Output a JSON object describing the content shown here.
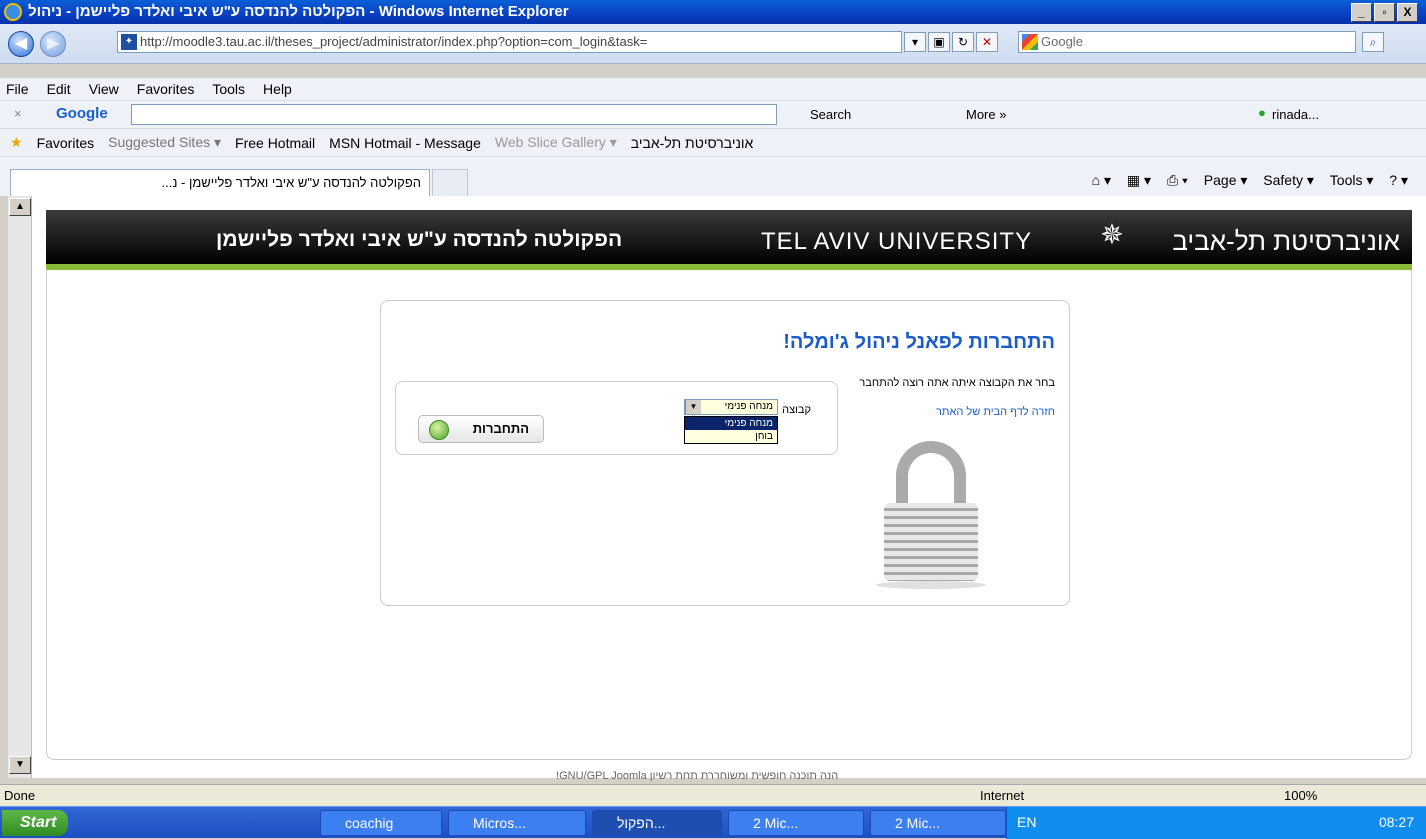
{
  "window": {
    "title": "הפקולטה להנדסה ע\"ש איבי ואלדר פליישמן - ניהול - Windows Internet Explorer",
    "min": "_",
    "max": "▫",
    "close": "X"
  },
  "addressbar": {
    "url": "http://moodle3.tau.ac.il/theses_project/administrator/index.php?option=com_login&task=",
    "search_placeholder": "Google"
  },
  "menu": [
    "File",
    "Edit",
    "View",
    "Favorites",
    "Tools",
    "Help"
  ],
  "googlebar": {
    "logo": "Google",
    "search": "Search",
    "more": "More »",
    "user": "rinada..."
  },
  "favorites": {
    "label": "Favorites",
    "items": [
      "Suggested Sites ▾",
      "Free Hotmail",
      "MSN Hotmail - Message",
      "Web Slice Gallery ▾",
      "אוניברסיטת תל-אביב"
    ]
  },
  "tab": {
    "label": "הפקולטה להנדסה ע\"ש איבי ואלדר פליישמן - נ..."
  },
  "commands": [
    "Page ▾",
    "Safety ▾",
    "Tools ▾"
  ],
  "header": {
    "faculty": "הפקולטה להנדסה ע\"ש איבי ואלדר פליישמן",
    "university_en": "TEL AVIV UNIVERSITY",
    "university_he": "אוניברסיטת תל-אביב"
  },
  "login": {
    "title": "התחברות לפאנל ניהול ג'ומלה!",
    "group_label": "קבוצה",
    "group_selected": "מנחה פנימי",
    "group_options": [
      "מנחה פנימי",
      "בוחן"
    ],
    "button": "התחברות",
    "instructions": "בחר את הקבוצה איתה אתה רוצה להתחבר",
    "home_link": "חזרה לדף הבית של האתר"
  },
  "footer": "הנה תוכנה חופשית ומשוחררת תחת רשיון GNU/GPL Joomla!",
  "status": {
    "text": "Done",
    "zone": "Internet",
    "zoom": "100%"
  },
  "taskbar": {
    "start": "Start",
    "buttons": [
      "coachig",
      "Micros...",
      "הפקול...",
      "2 Mic...",
      "2 Mic..."
    ],
    "lang": "EN",
    "clock": "08:27"
  },
  "colors": {
    "accent": "#1c5cc8",
    "header_bar": "#000000",
    "green_strip": "#8ab93a"
  }
}
